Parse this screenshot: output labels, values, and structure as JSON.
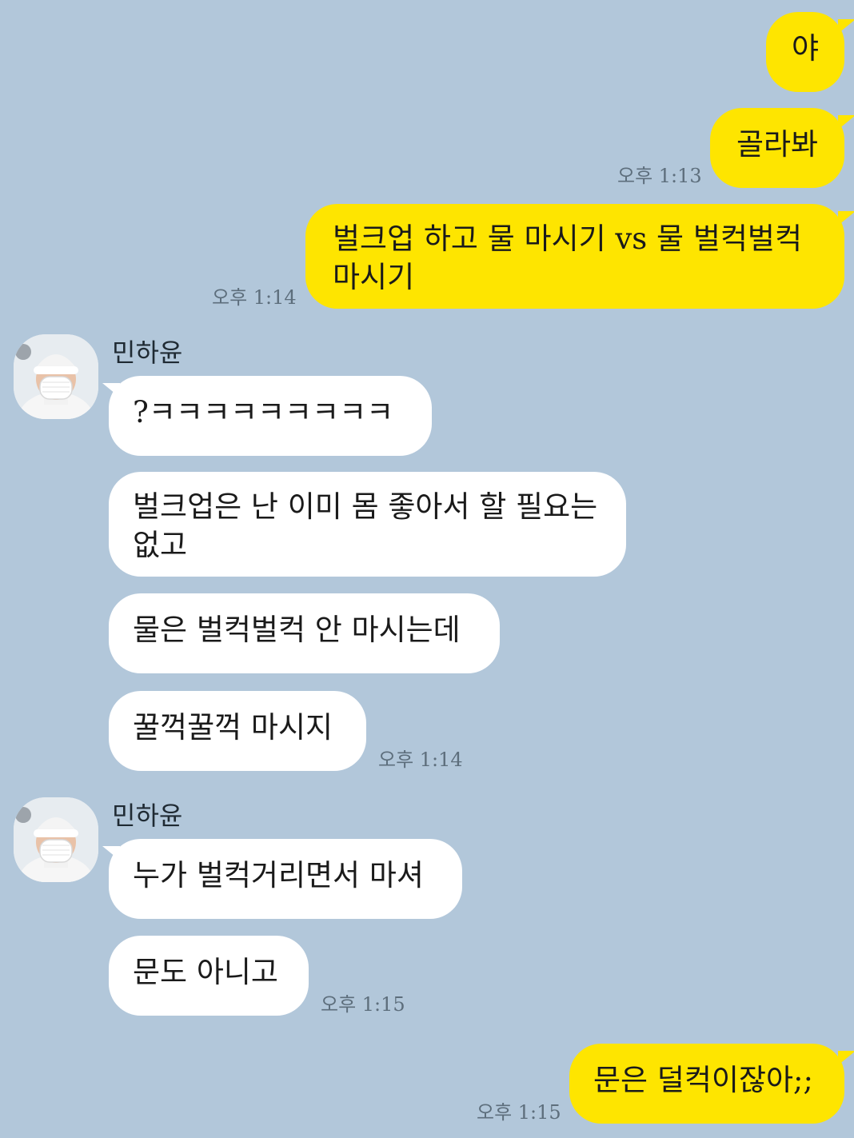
{
  "chat": {
    "contact_name": "민하윤",
    "messages": [
      {
        "text": "야"
      },
      {
        "text": "골라봐",
        "time": "오후 1:13"
      },
      {
        "text": "벌크업 하고 물 마시기 vs 물 벌컥벌컥 마시기",
        "time": "오후 1:14"
      },
      {
        "text": "?ㅋㅋㅋㅋㅋㅋㅋㅋㅋ"
      },
      {
        "text": "벌크업은 난 이미 몸 좋아서 할 필요는 없고"
      },
      {
        "text": "물은 벌컥벌컥 안 마시는데"
      },
      {
        "text": "꿀꺽꿀꺽 마시지",
        "time": "오후 1:14"
      },
      {
        "text": "누가 벌컥거리면서 마셔"
      },
      {
        "text": "문도 아니고",
        "time": "오후 1:15"
      },
      {
        "text": "문은 덜컥이잖아;;",
        "time": "오후 1:15"
      }
    ]
  },
  "colors": {
    "background": "#b2c7da",
    "outgoing_bubble": "#fee500",
    "incoming_bubble": "#ffffff",
    "timestamp": "#5d6e7c"
  },
  "icons": {
    "avatar": "profile-photo-person-white-beanie-mask"
  }
}
